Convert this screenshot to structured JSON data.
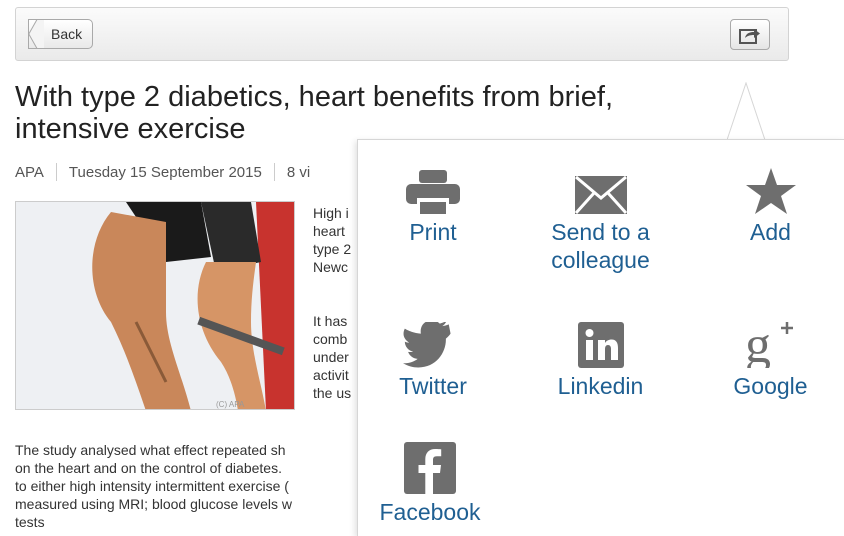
{
  "toolbar": {
    "back_label": "Back"
  },
  "article": {
    "title": "With type 2 diabetics, heart benefits from brief, intensive exercise",
    "source": "APA",
    "date": "Tuesday 15 September 2015",
    "views": "8 vi",
    "para1": "High i\nheart\ntype 2\nNewc",
    "para2": "It has\ncomb\nunder\nactivit\nthe us",
    "para3": "The study analysed what effect repeated sh\non the heart and on the control of diabetes.\nto either high intensity intermittent exercise (\nmeasured using MRI; blood glucose levels w\ntests",
    "photo_watermark": "(C) APA"
  },
  "share_menu": {
    "items": [
      {
        "id": "print",
        "label": "Print",
        "icon": "printer-icon"
      },
      {
        "id": "send",
        "label": "Send to a\ncolleague",
        "icon": "envelope-icon"
      },
      {
        "id": "add",
        "label": "Add",
        "icon": "star-icon"
      },
      {
        "id": "twitter",
        "label": "Twitter",
        "icon": "twitter-bird-icon"
      },
      {
        "id": "linkedin",
        "label": "Linkedin",
        "icon": "linkedin-icon"
      },
      {
        "id": "google",
        "label": "Google",
        "icon": "google-plus-icon"
      },
      {
        "id": "facebook",
        "label": "Facebook",
        "icon": "facebook-icon"
      }
    ]
  },
  "colors": {
    "link_blue": "#1f5f92",
    "icon_gray": "#6e6e6e"
  }
}
